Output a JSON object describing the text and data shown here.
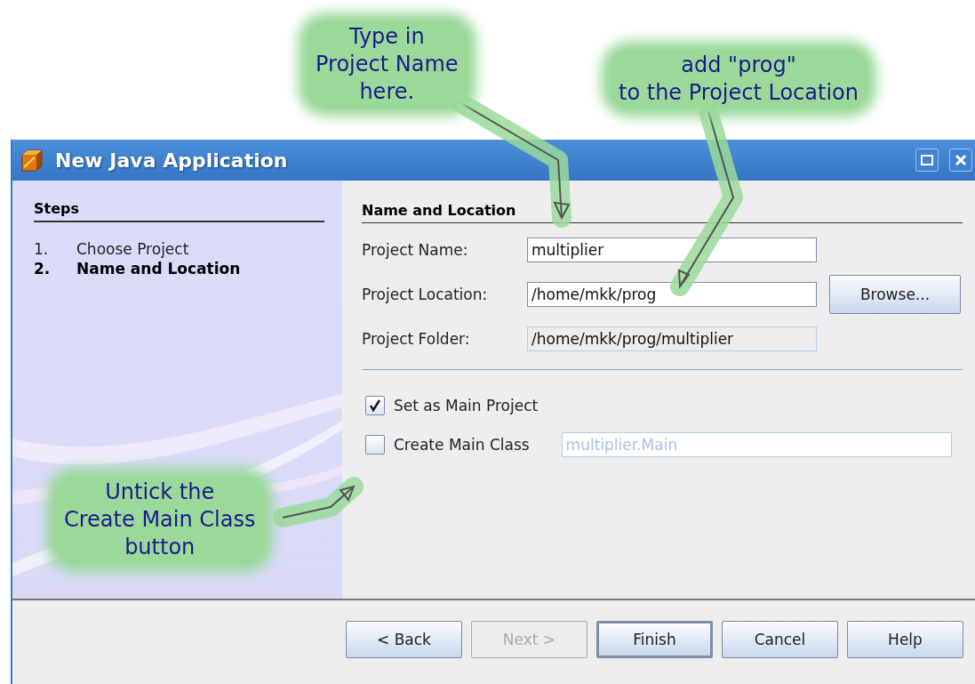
{
  "window": {
    "title": "New Java Application"
  },
  "steps": {
    "title": "Steps",
    "items": [
      {
        "number": "1.",
        "label": "Choose Project",
        "selected": false
      },
      {
        "number": "2.",
        "label": "Name and Location",
        "selected": true
      }
    ]
  },
  "panel_title": "Name and Location",
  "fields": [
    {
      "kind": "text",
      "label": "Project Name:",
      "value": "multiplier"
    },
    {
      "kind": "text",
      "label": "Project Location:",
      "value": "/home/mkk/prog",
      "button": "Browse..."
    },
    {
      "kind": "readonly",
      "label": "Project Folder:",
      "value": "/home/mkk/prog/multiplier"
    }
  ],
  "checkboxes": [
    {
      "label": "Set as Main Project",
      "checked": true
    },
    {
      "label": "Create Main Class",
      "checked": false,
      "field": {
        "value": "multiplier.Main",
        "disabled": true
      }
    }
  ],
  "buttons": [
    {
      "label": "< Back",
      "disabled": false,
      "focused": false
    },
    {
      "label": "Next >",
      "disabled": true,
      "focused": false
    },
    {
      "label": "Finish",
      "disabled": false,
      "focused": true
    },
    {
      "label": "Cancel",
      "disabled": false,
      "focused": false
    },
    {
      "label": "Help",
      "disabled": false,
      "focused": false
    }
  ],
  "annotations": [
    {
      "text": "Type in\nProject Name\nhere."
    },
    {
      "text": "add \"prog\"\nto the Project Location"
    },
    {
      "text": "Untick the\nCreate Main Class\nbutton"
    }
  ]
}
